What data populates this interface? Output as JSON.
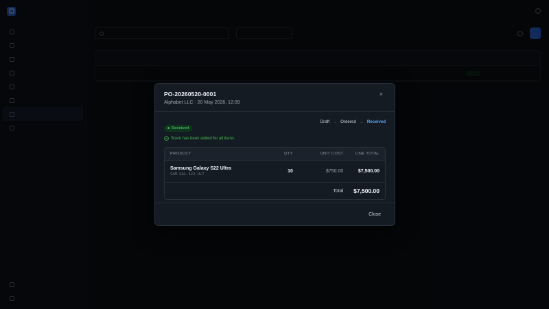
{
  "modal": {
    "title": "PO-20260520-0001",
    "subtitle": "Alphabet LLC · 20 May 2026, 12:09",
    "close_glyph": "×",
    "status_badge": "Received",
    "stock_note": "Stock has been added for all items",
    "steps": [
      "Draft",
      "Ordered",
      "Received"
    ],
    "step_arrow": "→",
    "table": {
      "headers": {
        "product": "PRODUCT",
        "qty": "QTY",
        "unit_cost": "UNIT COST",
        "line_total": "LINE TOTAL"
      },
      "items": [
        {
          "name": "Samsung Galaxy S22 Ultra",
          "sku": "SAM-GAL-S22-ULT",
          "qty": "10",
          "unit_cost": "$750.00",
          "line_total": "$7,500.00"
        }
      ],
      "total_label": "Total",
      "total_value": "$7,500.00"
    },
    "close_button": "Close"
  },
  "colors": {
    "accent": "#58a6ff",
    "success": "#3fb950",
    "brand": "#2f6fed"
  },
  "icons": {
    "close": "close-icon",
    "check": "check-circle-icon"
  }
}
